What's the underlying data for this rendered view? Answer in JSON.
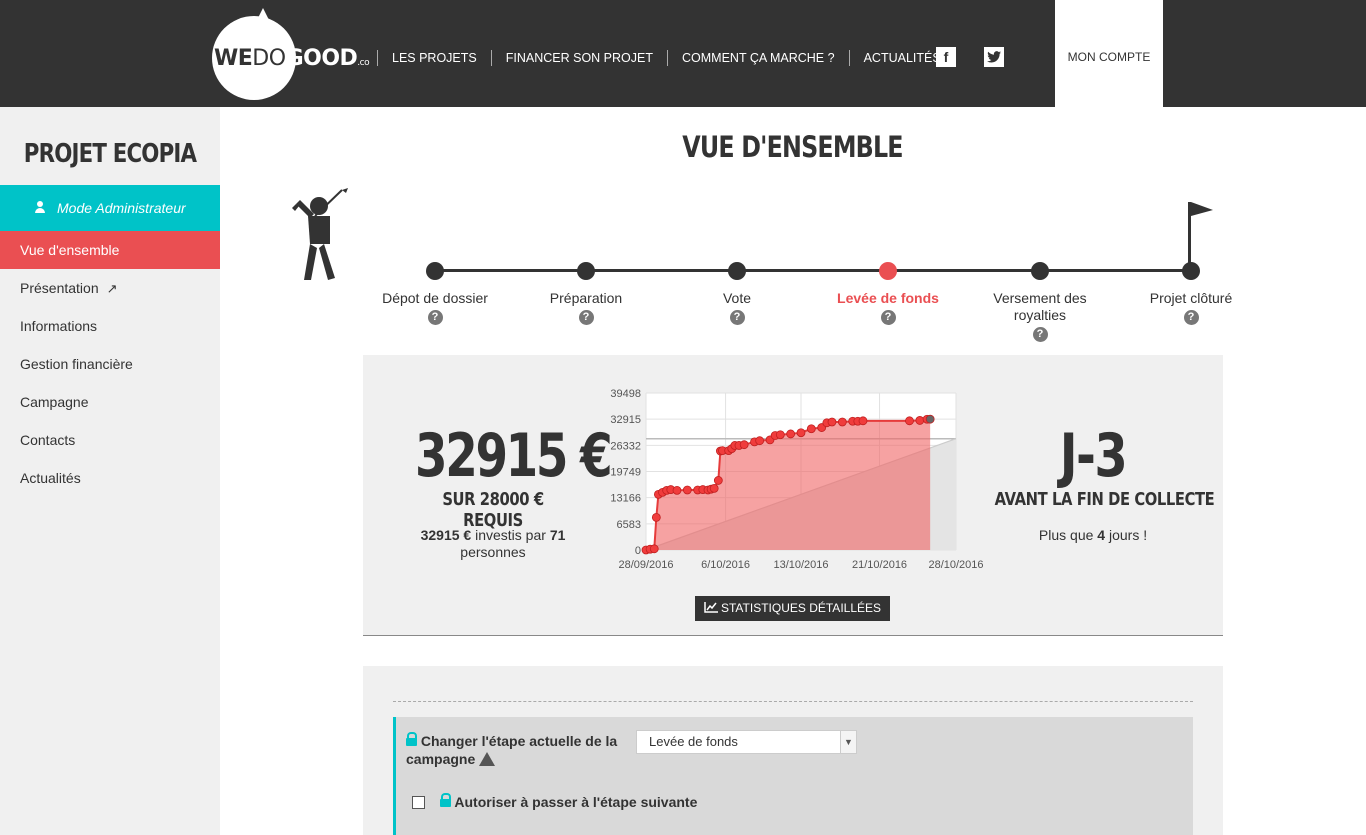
{
  "header": {
    "logo": {
      "we": "WE",
      "do": "DO",
      "good": "GOOD",
      "co": ".co"
    },
    "nav": [
      "LES PROJETS",
      "FINANCER SON PROJET",
      "COMMENT ÇA MARCHE ?",
      "ACTUALITÉS"
    ],
    "social": [
      {
        "icon": "facebook-icon",
        "glyph": "f"
      },
      {
        "icon": "twitter-icon",
        "glyph": "t"
      }
    ],
    "account": "MON COMPTE"
  },
  "sidebar": {
    "project_title": "PROJET ECOPIA",
    "admin_mode": "Mode Administrateur",
    "items": [
      {
        "label": "Vue d'ensemble",
        "active": true
      },
      {
        "label": "Présentation",
        "external": true
      },
      {
        "label": "Informations"
      },
      {
        "label": "Gestion financière"
      },
      {
        "label": "Campagne"
      },
      {
        "label": "Contacts"
      },
      {
        "label": "Actualités"
      }
    ]
  },
  "main": {
    "title": "VUE D'ENSEMBLE",
    "steps": [
      {
        "label": "Dépot de dossier"
      },
      {
        "label": "Préparation"
      },
      {
        "label": "Vote"
      },
      {
        "label": "Levée de fonds",
        "active": true
      },
      {
        "label": "Versement des royalties"
      },
      {
        "label": "Projet clôturé"
      }
    ]
  },
  "stats": {
    "amount": "32915 €",
    "required": "SUR 28000 € REQUIS",
    "invested_amount": "32915 €",
    "invested_text": " investis par ",
    "investors": "71",
    "investors_suffix": " personnes",
    "days": "J-3",
    "days_sub": "AVANT LA FIN DE COLLECTE",
    "days_left_prefix": "Plus que ",
    "days_left_value": "4",
    "days_left_suffix": " jours !",
    "button": "STATISTIQUES DÉTAILLÉES"
  },
  "chart_data": {
    "type": "line",
    "yticks": [
      0,
      6583,
      13166,
      19749,
      26332,
      32915,
      39498
    ],
    "xticks": [
      "28/09/2016",
      "6/10/2016",
      "13/10/2016",
      "21/10/2016",
      "28/10/2016"
    ],
    "ylim": [
      0,
      39498
    ],
    "x_days_range": [
      0,
      30
    ],
    "target": 28000,
    "series": [
      {
        "x": [
          0,
          0.4,
          0.8,
          1.0,
          1.2,
          1.6,
          2.0,
          2.4,
          3.0,
          4.0,
          5.0,
          5.5,
          6.0,
          6.3,
          6.6,
          7.0,
          7.2,
          7.4,
          8.0,
          8.3,
          8.6,
          9.0,
          9.5,
          10.5,
          11.0,
          12.0,
          12.5,
          13.0,
          14.0,
          15.0,
          16.0,
          17.0,
          17.5,
          18.0,
          19.0,
          20.0,
          20.5,
          21.0,
          25.5,
          26.5,
          27.2,
          27.5
        ],
        "y": [
          0,
          200,
          300,
          8200,
          14000,
          14500,
          15000,
          15200,
          15000,
          15100,
          15100,
          15200,
          15100,
          15300,
          15500,
          17500,
          24900,
          25000,
          25000,
          25500,
          26300,
          26300,
          26500,
          27200,
          27500,
          27700,
          28800,
          29000,
          29200,
          29500,
          30500,
          30800,
          32000,
          32200,
          32200,
          32400,
          32400,
          32500,
          32500,
          32600,
          32900,
          32915
        ]
      }
    ]
  },
  "settings": {
    "change_step_label": "Changer l'étape actuelle de la campagne",
    "select_value": "Levée de fonds",
    "allow_next_label": "Autoriser à passer à l'étape suivante"
  },
  "colors": {
    "accent": "#ea4f52",
    "teal": "#00c3c8",
    "dark": "#333333"
  }
}
